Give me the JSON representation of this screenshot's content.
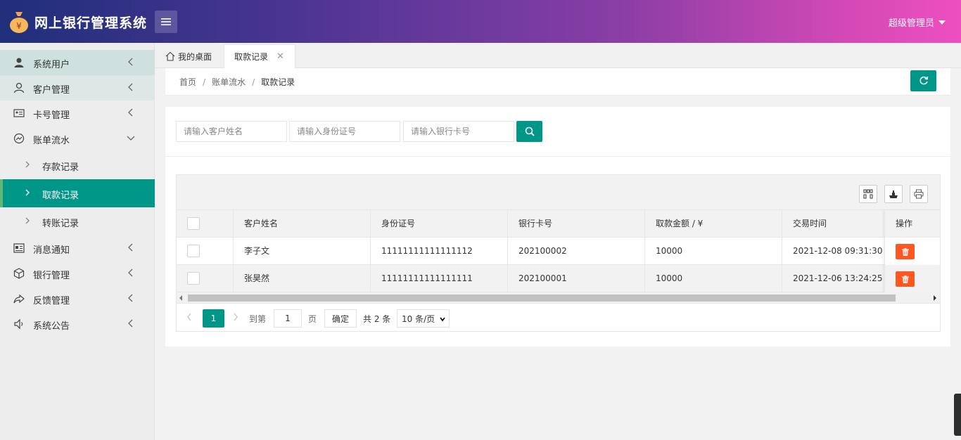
{
  "app": {
    "title": "网上银行管理系统",
    "user": "超级管理员"
  },
  "colors": {
    "primary": "#009688",
    "danger": "#ff5722",
    "header_start": "#1f2f7a",
    "header_end": "#ee4fc0"
  },
  "sidebar": {
    "items": [
      {
        "label": "系统用户",
        "icon": "user-icon"
      },
      {
        "label": "客户管理",
        "icon": "user-outline-icon"
      },
      {
        "label": "卡号管理",
        "icon": "id-card-icon"
      },
      {
        "label": "账单流水",
        "icon": "chart-line-icon"
      },
      {
        "label": "消息通知",
        "icon": "news-icon"
      },
      {
        "label": "银行管理",
        "icon": "cube-icon"
      },
      {
        "label": "反馈管理",
        "icon": "share-icon"
      },
      {
        "label": "系统公告",
        "icon": "speaker-icon"
      }
    ],
    "submenu": [
      {
        "label": "存款记录"
      },
      {
        "label": "取款记录"
      },
      {
        "label": "转账记录"
      }
    ]
  },
  "tabs": {
    "home": "我的桌面",
    "active": "取款记录"
  },
  "breadcrumb": {
    "home": "首页",
    "parent": "账单流水",
    "current": "取款记录"
  },
  "search": {
    "name_placeholder": "请输入客户姓名",
    "id_placeholder": "请输入身份证号",
    "card_placeholder": "请输入银行卡号"
  },
  "table": {
    "columns": [
      "客户姓名",
      "身份证号",
      "银行卡号",
      "取款金额 / ¥",
      "交易时间",
      "操作"
    ],
    "rows": [
      {
        "name": "李子文",
        "id_number": "11111111111111112",
        "card": "202100002",
        "amount": "10000",
        "time": "2021-12-08 09:31:30"
      },
      {
        "name": "张昊然",
        "id_number": "11111111111111111",
        "card": "202100001",
        "amount": "10000",
        "time": "2021-12-06 13:24:25"
      }
    ]
  },
  "pager": {
    "current": "1",
    "goto_label": "到第",
    "goto_value": "1",
    "page_label": "页",
    "confirm": "确定",
    "total": "共 2 条",
    "page_size": "10 条/页"
  }
}
